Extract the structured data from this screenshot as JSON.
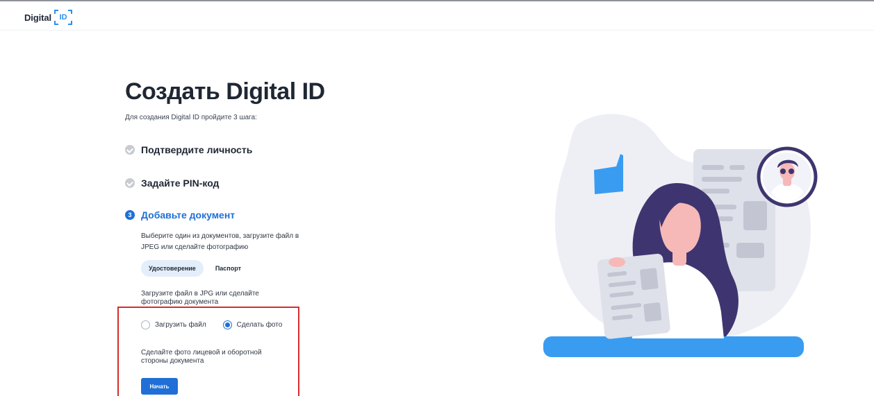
{
  "header": {
    "logo_text": "Digital",
    "logo_badge": "ID"
  },
  "page": {
    "title": "Создать Digital ID",
    "subtitle": "Для создания Digital ID пройдите 3 шага:"
  },
  "steps": [
    {
      "label": "Подтвердите личность",
      "status": "done"
    },
    {
      "label": "Задайте PIN-код",
      "status": "done"
    },
    {
      "label": "Добавьте документ",
      "status": "active",
      "number": "3"
    }
  ],
  "document_step": {
    "description": "Выберите один из документов, загрузите файл в JPEG или сделайте фотографию",
    "tabs": [
      {
        "label": "Удостоверение",
        "selected": true
      },
      {
        "label": "Паспорт",
        "selected": false
      }
    ],
    "upload_hint": "Загрузите файл в JPG или сделайте фотографию документа",
    "options": [
      {
        "label": "Загрузить файл",
        "checked": false
      },
      {
        "label": "Сделать фото",
        "checked": true
      }
    ],
    "photo_hint": "Сделайте фото лицевой и оборотной стороны документа",
    "start_button": "Начать"
  },
  "colors": {
    "accent": "#1f6fd6",
    "brand": "#2c8ef0",
    "highlight": "#d82b2b",
    "illustration_purple": "#3e3570",
    "illustration_blue": "#3a9cf0"
  },
  "illustration": {
    "icon": "woman-holding-document-illustration"
  }
}
